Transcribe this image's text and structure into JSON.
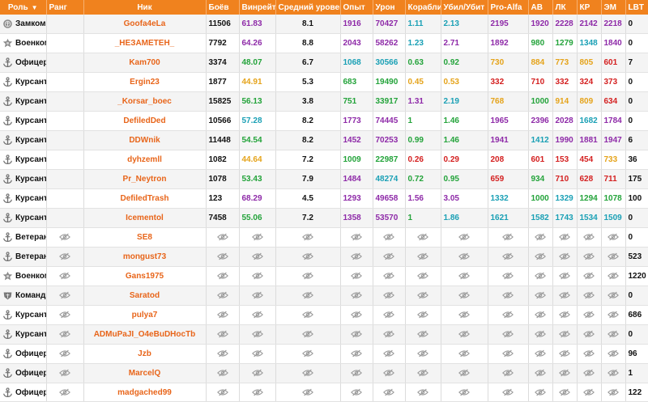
{
  "headers": {
    "role": "Роль",
    "rank": "Ранг",
    "nick": "Ник",
    "battles": "Боёв",
    "winrate": "Винрейт",
    "avg_level": "Средний уровень",
    "xp": "Опыт",
    "damage": "Урон",
    "ships": "Корабли",
    "kd": "Убил/Убит",
    "pro_alfa": "Pro-Alfa",
    "av": "АВ",
    "lk": "ЛК",
    "kr": "КР",
    "em": "ЭМ",
    "lbt": "LBT"
  },
  "colors": {
    "header_bg": "#f0821e",
    "nick": "#e8651a",
    "green": "#23a33a",
    "yellow": "#e5a31a",
    "purple": "#8e2aa8",
    "cyan": "#1aa0b5",
    "red": "#d42020",
    "orange": "#e07a10",
    "blue": "#3470d0"
  },
  "rows": [
    {
      "role": "Замком",
      "role_icon": "deputy-icon",
      "rank": "",
      "nick": "Goofa4eLa",
      "battles": "11506",
      "wr": "61.83",
      "wr_c": "purple",
      "avg": "8.1",
      "xp": "1916",
      "xp_c": "purple",
      "dmg": "70427",
      "dmg_c": "purple",
      "ships": "1.11",
      "ships_c": "cyan",
      "kd": "2.13",
      "kd_c": "cyan",
      "pa": "2195",
      "pa_c": "purple",
      "av": "1920",
      "av_c": "purple",
      "lk": "2228",
      "lk_c": "purple",
      "kr": "2142",
      "kr_c": "purple",
      "em": "2218",
      "em_c": "purple",
      "lbt": "0"
    },
    {
      "role": "Военком",
      "role_icon": "commissar-icon",
      "rank": "",
      "nick": "_НЕЗАМЕТЕН_",
      "battles": "7792",
      "wr": "64.26",
      "wr_c": "purple",
      "avg": "8.8",
      "xp": "2043",
      "xp_c": "purple",
      "dmg": "58262",
      "dmg_c": "purple",
      "ships": "1.23",
      "ships_c": "cyan",
      "kd": "2.71",
      "kd_c": "purple",
      "pa": "1892",
      "pa_c": "purple",
      "av": "980",
      "av_c": "green",
      "lk": "1279",
      "lk_c": "green",
      "kr": "1348",
      "kr_c": "cyan",
      "em": "1840",
      "em_c": "purple",
      "lbt": "0"
    },
    {
      "role": "Офицер",
      "role_icon": "anchor-icon",
      "rank": "",
      "nick": "Kam700",
      "battles": "3374",
      "wr": "48.07",
      "wr_c": "green",
      "avg": "6.7",
      "xp": "1068",
      "xp_c": "cyan",
      "dmg": "30566",
      "dmg_c": "cyan",
      "ships": "0.63",
      "ships_c": "green",
      "kd": "0.92",
      "kd_c": "green",
      "pa": "730",
      "pa_c": "yellow",
      "av": "884",
      "av_c": "yellow",
      "lk": "773",
      "lk_c": "yellow",
      "kr": "805",
      "kr_c": "yellow",
      "em": "601",
      "em_c": "red",
      "lbt": "7"
    },
    {
      "role": "Курсант",
      "role_icon": "anchor-icon",
      "rank": "",
      "nick": "Ergin23",
      "battles": "1877",
      "wr": "44.91",
      "wr_c": "yellow",
      "avg": "5.3",
      "xp": "683",
      "xp_c": "green",
      "dmg": "19490",
      "dmg_c": "green",
      "ships": "0.45",
      "ships_c": "yellow",
      "kd": "0.53",
      "kd_c": "yellow",
      "pa": "332",
      "pa_c": "red",
      "av": "710",
      "av_c": "red",
      "lk": "332",
      "lk_c": "red",
      "kr": "324",
      "kr_c": "red",
      "em": "373",
      "em_c": "red",
      "lbt": "0"
    },
    {
      "role": "Курсант",
      "role_icon": "anchor-icon",
      "rank": "",
      "nick": "_Korsar_boec",
      "battles": "15825",
      "wr": "56.13",
      "wr_c": "green",
      "avg": "3.8",
      "xp": "751",
      "xp_c": "green",
      "dmg": "33917",
      "dmg_c": "green",
      "ships": "1.31",
      "ships_c": "purple",
      "kd": "2.19",
      "kd_c": "cyan",
      "pa": "768",
      "pa_c": "yellow",
      "av": "1000",
      "av_c": "green",
      "lk": "914",
      "lk_c": "yellow",
      "kr": "809",
      "kr_c": "yellow",
      "em": "634",
      "em_c": "red",
      "lbt": "0"
    },
    {
      "role": "Курсант",
      "role_icon": "anchor-icon",
      "rank": "",
      "nick": "DefiledDed",
      "battles": "10566",
      "wr": "57.28",
      "wr_c": "cyan",
      "avg": "8.2",
      "xp": "1773",
      "xp_c": "purple",
      "dmg": "74445",
      "dmg_c": "purple",
      "ships": "1",
      "ships_c": "green",
      "kd": "1.46",
      "kd_c": "green",
      "pa": "1965",
      "pa_c": "purple",
      "av": "2396",
      "av_c": "purple",
      "lk": "2028",
      "lk_c": "purple",
      "kr": "1682",
      "kr_c": "cyan",
      "em": "1784",
      "em_c": "purple",
      "lbt": "0"
    },
    {
      "role": "Курсант",
      "role_icon": "anchor-icon",
      "rank": "",
      "nick": "DDWnik",
      "battles": "11448",
      "wr": "54.54",
      "wr_c": "green",
      "avg": "8.2",
      "xp": "1452",
      "xp_c": "purple",
      "dmg": "70253",
      "dmg_c": "purple",
      "ships": "0.99",
      "ships_c": "green",
      "kd": "1.46",
      "kd_c": "green",
      "pa": "1941",
      "pa_c": "purple",
      "av": "1412",
      "av_c": "cyan",
      "lk": "1990",
      "lk_c": "purple",
      "kr": "1881",
      "kr_c": "purple",
      "em": "1947",
      "em_c": "purple",
      "lbt": "6"
    },
    {
      "role": "Курсант",
      "role_icon": "anchor-icon",
      "rank": "",
      "nick": "dyhzemll",
      "battles": "1082",
      "wr": "44.64",
      "wr_c": "yellow",
      "avg": "7.2",
      "xp": "1009",
      "xp_c": "green",
      "dmg": "22987",
      "dmg_c": "green",
      "ships": "0.26",
      "ships_c": "red",
      "kd": "0.29",
      "kd_c": "red",
      "pa": "208",
      "pa_c": "red",
      "av": "601",
      "av_c": "red",
      "lk": "153",
      "lk_c": "red",
      "kr": "454",
      "kr_c": "red",
      "em": "733",
      "em_c": "yellow",
      "lbt": "36"
    },
    {
      "role": "Курсант",
      "role_icon": "anchor-icon",
      "rank": "",
      "nick": "Pr_Neytron",
      "battles": "1078",
      "wr": "53.43",
      "wr_c": "green",
      "avg": "7.9",
      "xp": "1484",
      "xp_c": "purple",
      "dmg": "48274",
      "dmg_c": "cyan",
      "ships": "0.72",
      "ships_c": "green",
      "kd": "0.95",
      "kd_c": "green",
      "pa": "659",
      "pa_c": "red",
      "av": "934",
      "av_c": "green",
      "lk": "710",
      "lk_c": "red",
      "kr": "628",
      "kr_c": "red",
      "em": "711",
      "em_c": "red",
      "lbt": "175"
    },
    {
      "role": "Курсант",
      "role_icon": "anchor-icon",
      "rank": "",
      "nick": "DefiledTrash",
      "battles": "123",
      "wr": "68.29",
      "wr_c": "purple",
      "avg": "4.5",
      "xp": "1293",
      "xp_c": "purple",
      "dmg": "49658",
      "dmg_c": "purple",
      "ships": "1.56",
      "ships_c": "purple",
      "kd": "3.05",
      "kd_c": "purple",
      "pa": "1332",
      "pa_c": "cyan",
      "av": "1000",
      "av_c": "green",
      "lk": "1329",
      "lk_c": "cyan",
      "kr": "1294",
      "kr_c": "green",
      "em": "1078",
      "em_c": "green",
      "lbt": "100"
    },
    {
      "role": "Курсант",
      "role_icon": "anchor-icon",
      "rank": "",
      "nick": "Icementol",
      "battles": "7458",
      "wr": "55.06",
      "wr_c": "green",
      "avg": "7.2",
      "xp": "1358",
      "xp_c": "purple",
      "dmg": "53570",
      "dmg_c": "purple",
      "ships": "1",
      "ships_c": "green",
      "kd": "1.86",
      "kd_c": "cyan",
      "pa": "1621",
      "pa_c": "cyan",
      "av": "1582",
      "av_c": "cyan",
      "lk": "1743",
      "lk_c": "cyan",
      "kr": "1534",
      "kr_c": "cyan",
      "em": "1509",
      "em_c": "cyan",
      "lbt": "0"
    },
    {
      "role": "Ветеран",
      "role_icon": "anchor-icon",
      "rank": "",
      "nick": "SE8",
      "hidden": true,
      "lbt": "0"
    },
    {
      "role": "Ветеран",
      "role_icon": "anchor-icon",
      "rank": "",
      "nick": "mongust73",
      "hidden": true,
      "lbt": "523"
    },
    {
      "role": "Военком",
      "role_icon": "commissar-icon",
      "rank": "",
      "nick": "Gans1975",
      "hidden": true,
      "lbt": "1220"
    },
    {
      "role": "Командир",
      "role_icon": "commander-icon",
      "rank": "",
      "nick": "Saratod",
      "hidden": true,
      "lbt": "0"
    },
    {
      "role": "Курсант",
      "role_icon": "anchor-icon",
      "rank": "",
      "nick": "pulya7",
      "hidden": true,
      "lbt": "686"
    },
    {
      "role": "Курсант",
      "role_icon": "anchor-icon",
      "rank": "",
      "nick": "ADMuPaJI_O4eBuDHocTb",
      "hidden": true,
      "lbt": "0"
    },
    {
      "role": "Офицер",
      "role_icon": "anchor-icon",
      "rank": "",
      "nick": "Jzb",
      "hidden": true,
      "lbt": "96"
    },
    {
      "role": "Офицер",
      "role_icon": "anchor-icon",
      "rank": "",
      "nick": "MarcelQ",
      "hidden": true,
      "lbt": "1"
    },
    {
      "role": "Офицер",
      "role_icon": "anchor-icon",
      "rank": "",
      "nick": "madgached99",
      "hidden": true,
      "lbt": "122"
    }
  ]
}
